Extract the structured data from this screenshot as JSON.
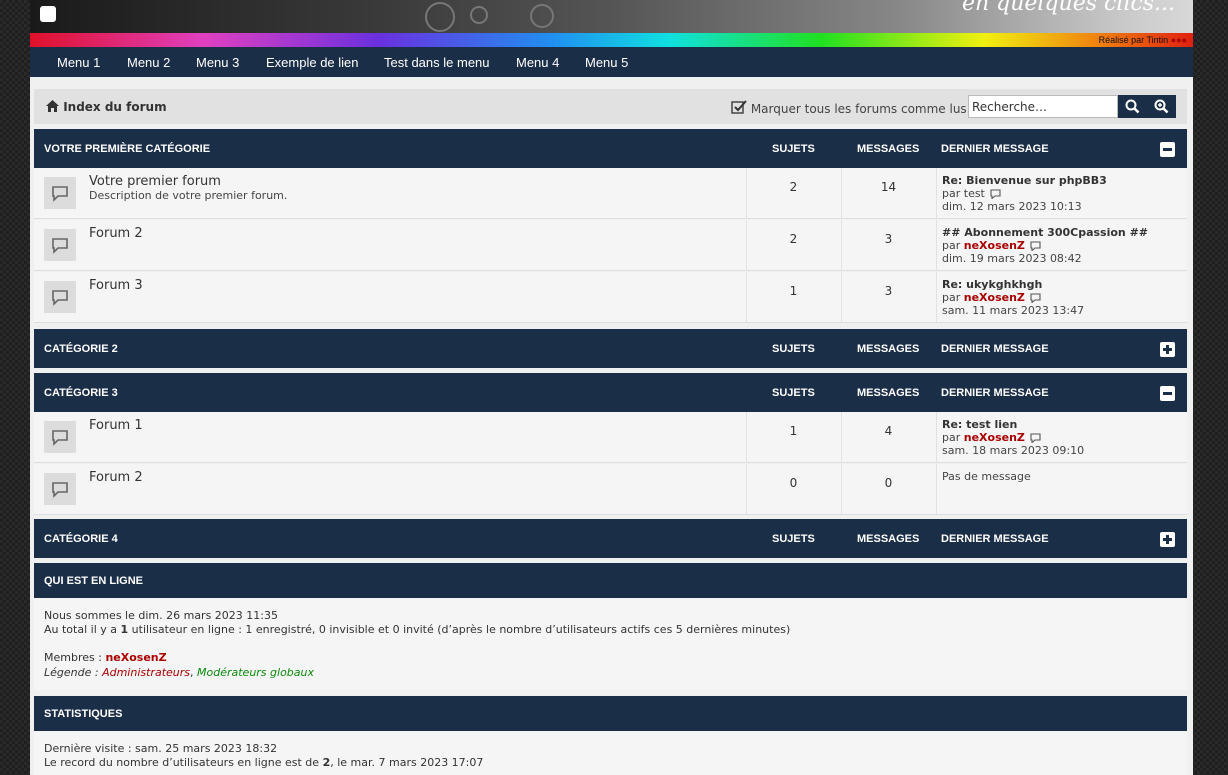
{
  "header": {
    "slogan": "en quelques clics...",
    "credit_prefix": "Réalisé par",
    "credit_name": "Tintin",
    "credit_mark": "●●●"
  },
  "nav": {
    "menu": [
      "Menu 1",
      "Menu 2",
      "Menu 3",
      "Exemple de lien",
      "Test dans le menu",
      "Menu 4",
      "Menu 5"
    ]
  },
  "breadcrumb": {
    "home_label": "Index du forum",
    "mark_read_label": "Marquer tous les forums comme lus",
    "search_placeholder": "Recherche…"
  },
  "columns": {
    "topics": "SUJETS",
    "posts": "MESSAGES",
    "last_post": "DERNIER MESSAGE"
  },
  "categories": [
    {
      "title": "VOTRE PREMIÈRE CATÉGORIE",
      "collapsed": false,
      "forums": [
        {
          "name": "Votre premier forum",
          "description": "Description de votre premier forum.",
          "topics": "2",
          "posts": "14",
          "last_title": "Re: Bienvenue sur phpBB3",
          "by": "par",
          "last_user": "test",
          "user_colored": false,
          "last_date": "dim. 12 mars 2023 10:13"
        },
        {
          "name": "Forum 2",
          "description": "",
          "topics": "2",
          "posts": "3",
          "last_title": "## Abonnement 300Cpassion ##",
          "by": "par",
          "last_user": "neXosenZ",
          "user_colored": true,
          "last_date": "dim. 19 mars 2023 08:42"
        },
        {
          "name": "Forum 3",
          "description": "",
          "topics": "1",
          "posts": "3",
          "last_title": "Re: ukykghkhgh",
          "by": "par",
          "last_user": "neXosenZ",
          "user_colored": true,
          "last_date": "sam. 11 mars 2023 13:47"
        }
      ]
    },
    {
      "title": "CATÉGORIE 2",
      "collapsed": true,
      "forums": []
    },
    {
      "title": "CATÉGORIE 3",
      "collapsed": false,
      "forums": [
        {
          "name": "Forum 1",
          "description": "",
          "topics": "1",
          "posts": "4",
          "last_title": "Re: test lien",
          "by": "par",
          "last_user": "neXosenZ",
          "user_colored": true,
          "last_date": "sam. 18 mars 2023 09:10"
        },
        {
          "name": "Forum 2",
          "description": "",
          "topics": "0",
          "posts": "0",
          "no_message": "Pas de message"
        }
      ]
    },
    {
      "title": "CATÉGORIE 4",
      "collapsed": true,
      "forums": []
    }
  ],
  "online": {
    "title": "QUI EST EN LIGNE",
    "now": "Nous sommes le dim. 26 mars 2023 11:35",
    "total_prefix": "Au total il y a",
    "total_count": "1",
    "total_suffix": "utilisateur en ligne : 1 enregistré, 0 invisible et 0 invité (d’après le nombre d’utilisateurs actifs ces 5 dernières minutes)",
    "members_label": "Membres :",
    "members": "neXosenZ",
    "legend_label": "Légende :",
    "legend_admins": "Administrateurs",
    "legend_sep": ",",
    "legend_mods": "Modérateurs globaux"
  },
  "stats": {
    "title": "STATISTIQUES",
    "last_visit": "Dernière visite : sam. 25 mars 2023 18:32",
    "record_prefix": "Le record du nombre d’utilisateurs en ligne est de",
    "record_count": "2",
    "record_suffix": ", le mar. 7 mars 2023 17:07"
  },
  "colors": {
    "navy": "#1b2e48",
    "user_red": "#aa0000",
    "mod_green": "#0a8a0a"
  }
}
